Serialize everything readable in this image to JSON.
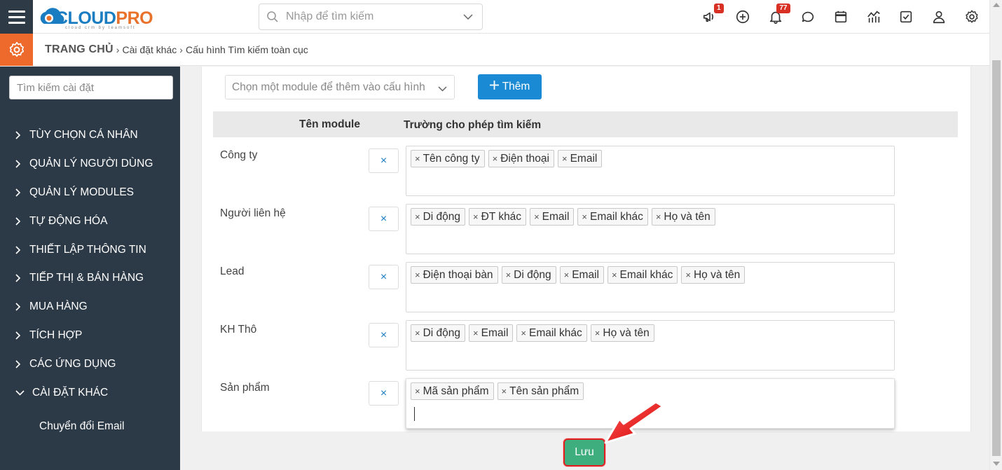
{
  "app": {
    "logo_text_a": "CLOUD",
    "logo_text_b": "PRO",
    "logo_tagline": "cloud crm by teamsoft",
    "brand_blue": "#1a7cc1",
    "brand_orange": "#ee6a2c"
  },
  "header": {
    "search_placeholder": "Nhập để tìm kiếm",
    "icons": [
      {
        "name": "megaphone-icon",
        "badge": "1"
      },
      {
        "name": "plus-circle-icon",
        "badge": ""
      },
      {
        "name": "bell-icon",
        "badge": "77"
      },
      {
        "name": "chat-icon",
        "badge": ""
      },
      {
        "name": "calendar-icon",
        "badge": ""
      },
      {
        "name": "chart-icon",
        "badge": ""
      },
      {
        "name": "checkbox-icon",
        "badge": ""
      },
      {
        "name": "user-icon",
        "badge": ""
      },
      {
        "name": "settings-icon",
        "badge": ""
      }
    ]
  },
  "breadcrumb": {
    "home": "TRANG CHỦ",
    "level1": "Cài đặt khác",
    "level2": "Cấu hình Tìm kiếm toàn cục"
  },
  "sidebar": {
    "search_placeholder": "Tìm kiếm cài đặt",
    "items": [
      {
        "label": "TÙY CHỌN CÁ NHÂN"
      },
      {
        "label": "QUẢN LÝ NGƯỜI DÙNG"
      },
      {
        "label": "QUẢN LÝ MODULES"
      },
      {
        "label": "TỰ ĐỘNG HÓA"
      },
      {
        "label": "THIẾT LẬP THÔNG TIN"
      },
      {
        "label": "TIẾP THỊ & BÁN HÀNG"
      },
      {
        "label": "MUA HÀNG"
      },
      {
        "label": "TÍCH HỢP"
      },
      {
        "label": "CÁC ỨNG DỤNG"
      },
      {
        "label": "CÀI ĐẶT KHÁC"
      }
    ],
    "sub_item": "Chuyển đổi Email"
  },
  "main": {
    "module_select_placeholder": "Chọn một module để thêm vào cấu hình",
    "add_button": "Thêm",
    "col_module": "Tên module",
    "col_fields": "Trường cho phép tìm kiếm",
    "remove_symbol": "×",
    "tag_remove_symbol": "×",
    "rows": [
      {
        "module": "Công ty",
        "fields": [
          "Tên công ty",
          "Điện thoại",
          "Email"
        ]
      },
      {
        "module": "Người liên hệ",
        "fields": [
          "Di động",
          "ĐT khác",
          "Email",
          "Email khác",
          "Họ và tên"
        ]
      },
      {
        "module": "Lead",
        "fields": [
          "Điện thoại bàn",
          "Di động",
          "Email",
          "Email khác",
          "Họ và tên"
        ]
      },
      {
        "module": "KH Thô",
        "fields": [
          "Di động",
          "Email",
          "Email khác",
          "Họ và tên"
        ]
      },
      {
        "module": "Sản phẩm",
        "fields": [
          "Mã sản phẩm",
          "Tên sản phẩm"
        ]
      }
    ],
    "save_button": "Lưu",
    "save_color": "#3fae7e",
    "add_color": "#1a8ad4"
  }
}
